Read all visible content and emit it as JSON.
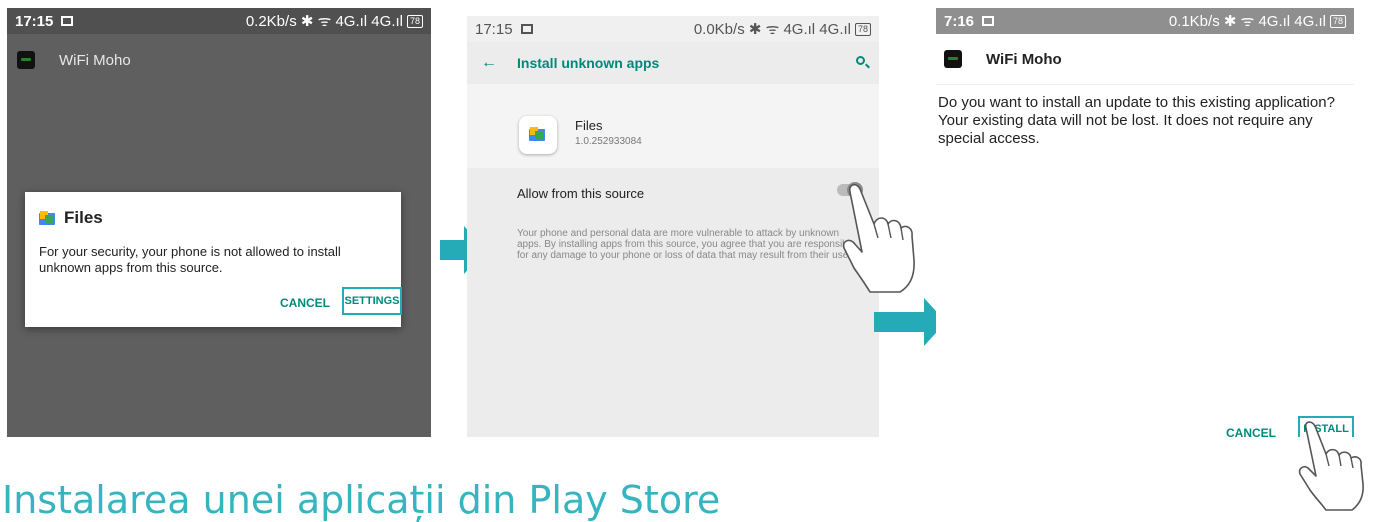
{
  "colors": {
    "accent": "#25aab7",
    "teal_text": "#00897b",
    "caption": "#36b5c1"
  },
  "screen1": {
    "status": {
      "time": "17:15",
      "right": "0.2Kb/s ✱ ᯤ 4G.ıl 4G.ıl",
      "battery": "78"
    },
    "app_title": "WiFi Moho",
    "dialog": {
      "title": "Files",
      "message": "For your security, your phone is not allowed to install unknown apps from this source.",
      "cancel": "CANCEL",
      "settings": "SETTINGS"
    }
  },
  "screen2": {
    "status": {
      "time": "17:15",
      "right": "0.0Kb/s ✱ ᯤ 4G.ıl 4G.ıl",
      "battery": "78"
    },
    "title": "Install unknown apps",
    "app_name": "Files",
    "app_version": "1.0.252933084",
    "allow_label": "Allow from this source",
    "allow_value": false,
    "warning": "Your phone and personal data are more vulnerable to attack by unknown apps. By installing apps from this source, you agree that you are responsible for any damage to your phone or loss of data that may result from their use."
  },
  "screen3": {
    "status": {
      "time": "7:16",
      "right": "0.1Kb/s ✱ ᯤ 4G.ıl 4G.ıl",
      "battery": "78"
    },
    "app_title": "WiFi Moho",
    "question": "Do you want to install an update to this existing application? Your existing data will not be lost. It does not require any special access.",
    "cancel": "CANCEL",
    "install": "INSTALL"
  },
  "caption": "Instalarea unei aplicații din Play Store"
}
